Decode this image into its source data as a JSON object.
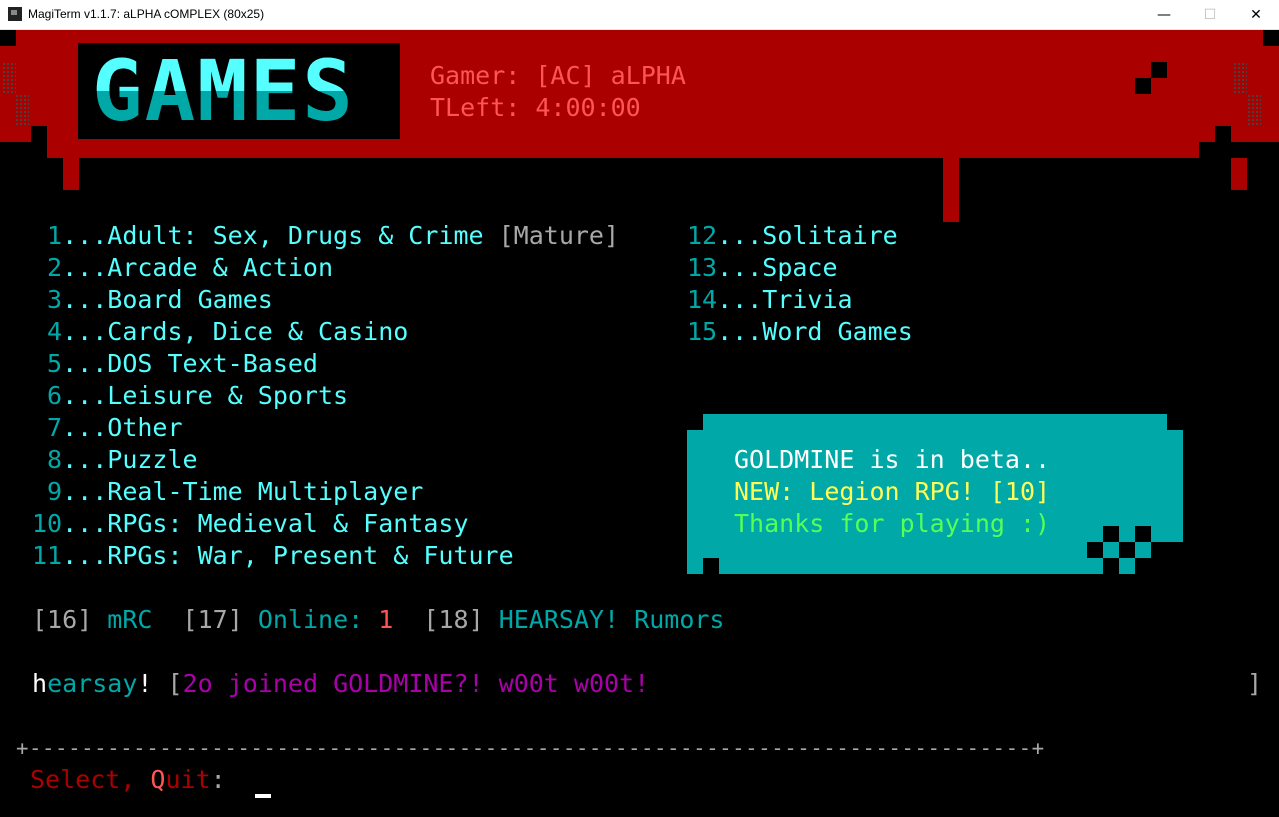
{
  "window": {
    "title": "MagiTerm v1.1.7: aLPHA cOMPLEX (80x25)",
    "controls": {
      "minimize": "—",
      "maximize": "☐",
      "close": "✕"
    }
  },
  "header": {
    "logo": "GAMES",
    "gamer_label": "Gamer:",
    "gamer_value": "[AC] aLPHA",
    "time_label": "TLeft:",
    "time_value": "4:00:00"
  },
  "menu_left": [
    {
      "num": " 1",
      "dots": "...",
      "label": "Adult: Sex, Drugs & Crime",
      "tag": "[Mature]"
    },
    {
      "num": " 2",
      "dots": "...",
      "label": "Arcade & Action"
    },
    {
      "num": " 3",
      "dots": "...",
      "label": "Board Games"
    },
    {
      "num": " 4",
      "dots": "...",
      "label": "Cards, Dice & Casino"
    },
    {
      "num": " 5",
      "dots": "...",
      "label": "DOS Text-Based"
    },
    {
      "num": " 6",
      "dots": "...",
      "label": "Leisure & Sports"
    },
    {
      "num": " 7",
      "dots": "...",
      "label": "Other"
    },
    {
      "num": " 8",
      "dots": "...",
      "label": "Puzzle"
    },
    {
      "num": " 9",
      "dots": "...",
      "label": "Real-Time Multiplayer"
    },
    {
      "num": "10",
      "dots": "...",
      "label": "RPGs: Medieval & Fantasy"
    },
    {
      "num": "11",
      "dots": "...",
      "label": "RPGs: War, Present & Future"
    }
  ],
  "menu_right": [
    {
      "num": "12",
      "dots": "...",
      "label": "Solitaire"
    },
    {
      "num": "13",
      "dots": "...",
      "label": "Space"
    },
    {
      "num": "14",
      "dots": "...",
      "label": "Trivia"
    },
    {
      "num": "15",
      "dots": "...",
      "label": "Word Games"
    }
  ],
  "notice": {
    "line1": "GOLDMINE is in beta..",
    "line2_new": "NEW:",
    "line2_rest": " Legion RPG! [10]",
    "line3": "Thanks for playing :)"
  },
  "extras": {
    "mrc_key": "[16]",
    "mrc_label": "mRC",
    "online_key": "[17]",
    "online_label": "Online:",
    "online_count": "1",
    "hearsay_key": "[18]",
    "hearsay_label": "HEARSAY! Rumors"
  },
  "hearsay_line": {
    "h": "h",
    "earsay": "earsay",
    "bang": "!",
    "open": "[",
    "message": "2o joined GOLDMINE?! w00t w00t!",
    "close": "]"
  },
  "separator": "+-----------------------------------------------------------------------------+",
  "prompt": {
    "select": "Select,",
    "quit_q": "Q",
    "quit_rest": "uit",
    "colon": ":"
  },
  "colors": {
    "banner_red": "#aa0000",
    "cyan": "#00a8a8",
    "bright_cyan": "#55ffff",
    "light_red": "#ff5555",
    "magenta": "#aa00aa",
    "yellow": "#ffff55",
    "green": "#55ff55"
  }
}
